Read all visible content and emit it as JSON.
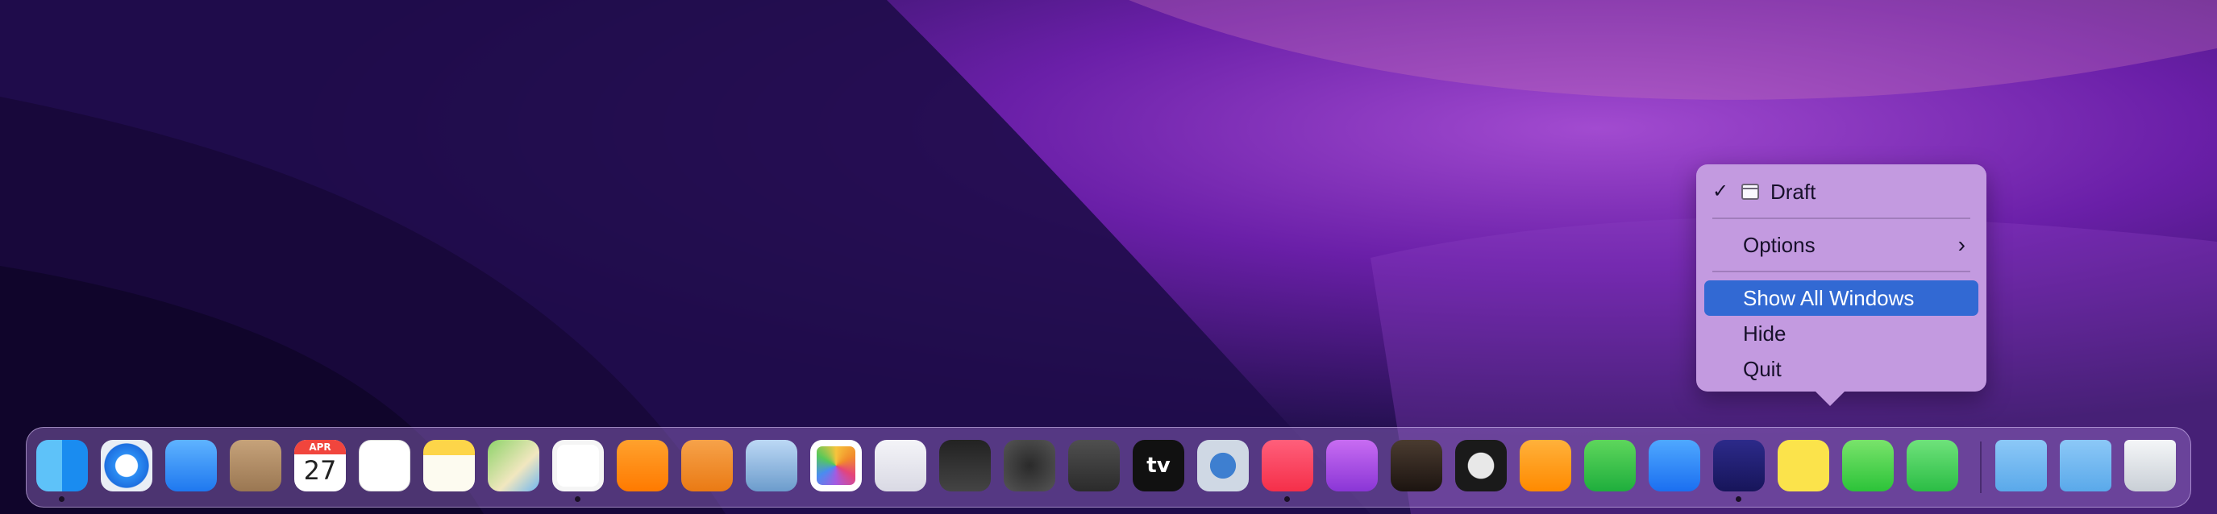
{
  "menu": {
    "items": [
      {
        "label": "Draft",
        "checked": true
      },
      {
        "label": "Options",
        "submenu": true
      },
      {
        "label": "Show All Windows",
        "selected": true
      },
      {
        "label": "Hide"
      },
      {
        "label": "Quit"
      }
    ],
    "check_glyph": "✓",
    "chevron_glyph": "›"
  },
  "dock": {
    "calendar": {
      "month": "APR",
      "day": "27"
    },
    "tv_label": "tv",
    "apps": [
      {
        "name": "finder-icon",
        "running": true
      },
      {
        "name": "safari-icon"
      },
      {
        "name": "mail-icon"
      },
      {
        "name": "contacts-icon"
      },
      {
        "name": "calendar-icon"
      },
      {
        "name": "reminders-icon"
      },
      {
        "name": "notes-icon"
      },
      {
        "name": "maps-icon"
      },
      {
        "name": "news-icon",
        "running": true
      },
      {
        "name": "books-icon"
      },
      {
        "name": "keynote-remote-icon"
      },
      {
        "name": "preview-icon"
      },
      {
        "name": "photos-icon"
      },
      {
        "name": "imovie-icon"
      },
      {
        "name": "final-cut-pro-icon"
      },
      {
        "name": "motion-icon"
      },
      {
        "name": "compressor-icon"
      },
      {
        "name": "apple-tv-icon"
      },
      {
        "name": "quicktime-icon"
      },
      {
        "name": "music-icon",
        "running": true
      },
      {
        "name": "podcasts-icon"
      },
      {
        "name": "garageband-icon"
      },
      {
        "name": "logic-pro-icon"
      },
      {
        "name": "pages-icon"
      },
      {
        "name": "numbers-icon"
      },
      {
        "name": "keynote-icon"
      },
      {
        "name": "draft-app-icon",
        "running": true
      },
      {
        "name": "basecamp-icon"
      },
      {
        "name": "messages-icon"
      },
      {
        "name": "facetime-icon"
      },
      {
        "name": "applications-folder-icon"
      },
      {
        "name": "downloads-folder-icon"
      },
      {
        "name": "trash-icon"
      }
    ]
  }
}
